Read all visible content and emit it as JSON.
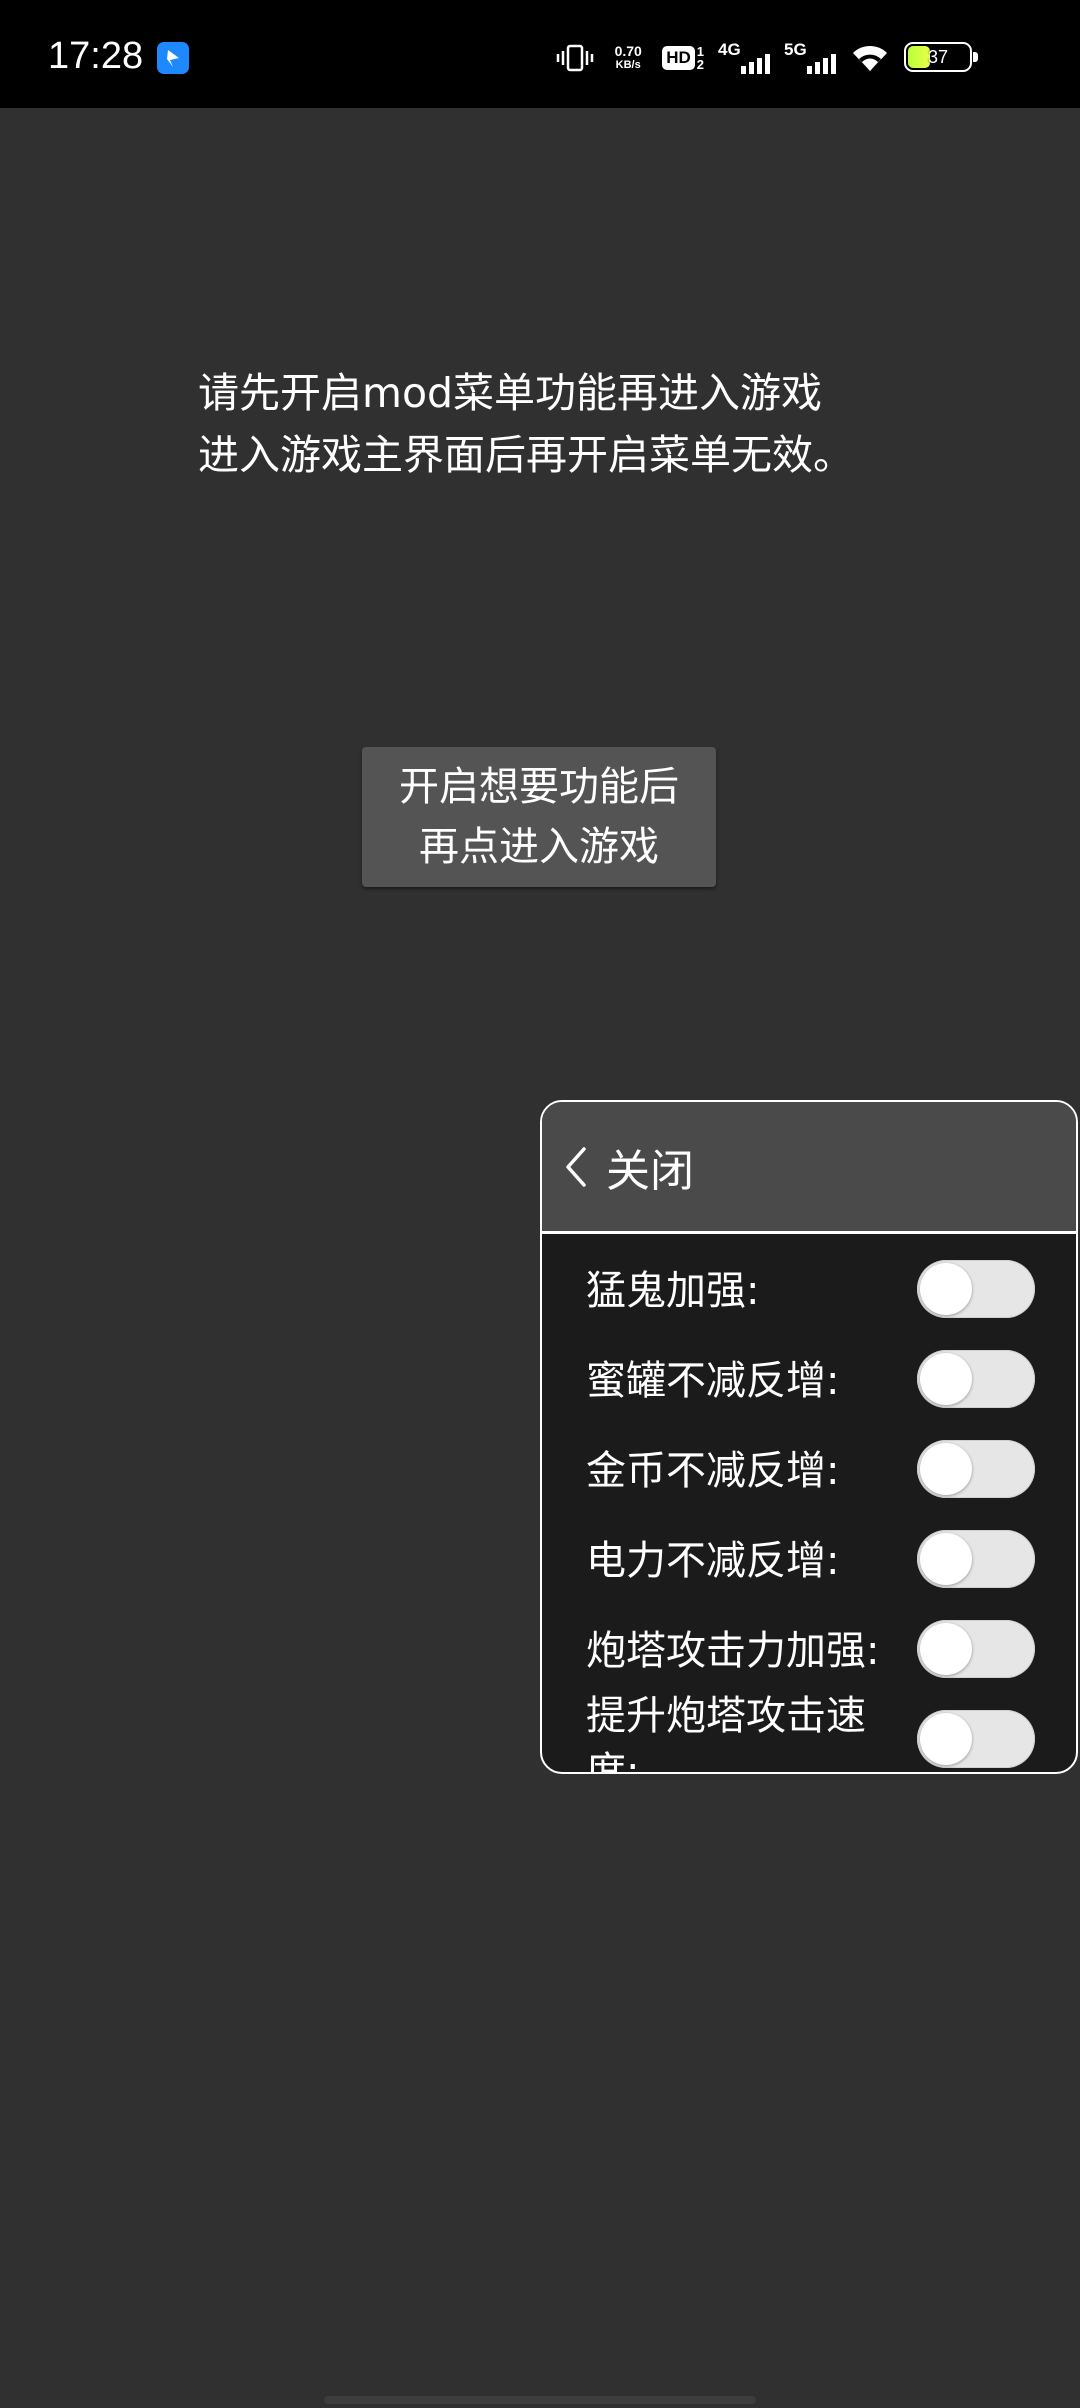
{
  "status_bar": {
    "time": "17:28",
    "speed_value": "0.70",
    "speed_unit": "KB/s",
    "hd_label": "HD",
    "hd_top": "1",
    "hd_bottom": "2",
    "net1_label": "4G",
    "net2_label": "5G",
    "battery_percent": "37",
    "battery_level": 0.37,
    "battery_color": "#c8ff3c"
  },
  "main": {
    "instruction_line1": "请先开启mod菜单功能再进入游戏",
    "instruction_line2": "进入游戏主界面后再开启菜单无效。",
    "enter_button_line1": "开启想要功能后",
    "enter_button_line2": "再点进入游戏"
  },
  "mod_menu": {
    "close_label": "关闭",
    "items": [
      {
        "label": "猛鬼加强:",
        "enabled": false
      },
      {
        "label": "蜜罐不减反增:",
        "enabled": false
      },
      {
        "label": "金币不减反增:",
        "enabled": false
      },
      {
        "label": "电力不减反增:",
        "enabled": false
      },
      {
        "label": "炮塔攻击力加强:",
        "enabled": false
      },
      {
        "label": "提升炮塔攻击速度:",
        "enabled": false
      }
    ]
  },
  "colors": {
    "background": "#303030",
    "button": "#545454",
    "menu_header": "#4a4a4a",
    "menu_body": "#1b1b1b",
    "toggle_off": "#e6e6e6"
  }
}
